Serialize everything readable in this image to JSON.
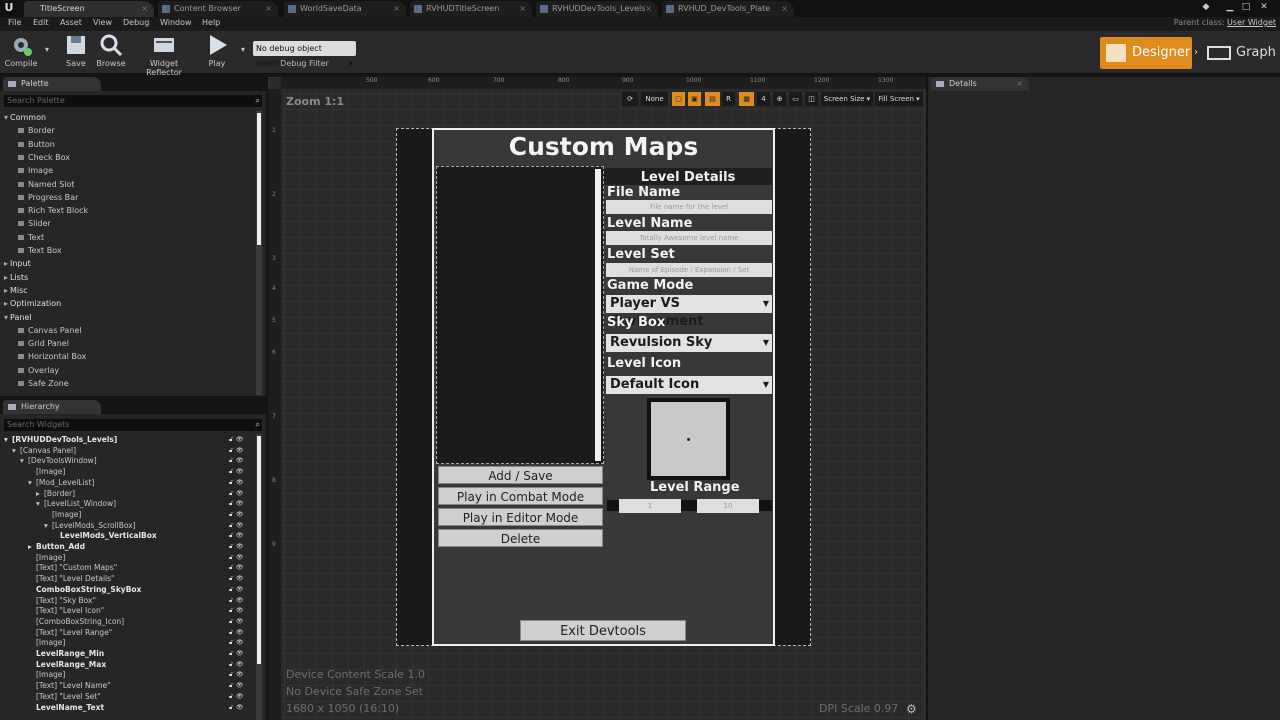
{
  "tabs": [
    {
      "label": "TitleScreen",
      "active": true
    },
    {
      "label": "Content Browser",
      "active": false
    },
    {
      "label": "WorldSaveData",
      "active": false
    },
    {
      "label": "RVHUDTitleScreen",
      "active": false
    },
    {
      "label": "RVHUDDevTools_Levels",
      "active": false
    },
    {
      "label": "RVHUD_DevTools_Plate",
      "active": false
    }
  ],
  "menu": [
    "File",
    "Edit",
    "Asset",
    "View",
    "Debug",
    "Window",
    "Help"
  ],
  "parent_class": {
    "prefix": "Parent class:",
    "value": "User Widget"
  },
  "toolbar": {
    "compile": "Compile",
    "save": "Save",
    "browse": "Browse",
    "widget_reflector": "Widget Reflector",
    "play": "Play",
    "debug_select": "No debug object selected",
    "debug_filter": "Debug Filter",
    "designer": "Designer",
    "graph": "Graph"
  },
  "palette": {
    "tab": "Palette",
    "search_placeholder": "Search Palette",
    "rows": [
      {
        "type": "cat",
        "label": "Common",
        "open": true
      },
      {
        "type": "item",
        "label": "Border"
      },
      {
        "type": "item",
        "label": "Button"
      },
      {
        "type": "item",
        "label": "Check Box"
      },
      {
        "type": "item",
        "label": "Image"
      },
      {
        "type": "item",
        "label": "Named Slot"
      },
      {
        "type": "item",
        "label": "Progress Bar"
      },
      {
        "type": "item",
        "label": "Rich Text Block"
      },
      {
        "type": "item",
        "label": "Slider"
      },
      {
        "type": "item",
        "label": "Text"
      },
      {
        "type": "item",
        "label": "Text Box"
      },
      {
        "type": "cat",
        "label": "Input",
        "open": false
      },
      {
        "type": "cat",
        "label": "Lists",
        "open": false
      },
      {
        "type": "cat",
        "label": "Misc",
        "open": false
      },
      {
        "type": "cat",
        "label": "Optimization",
        "open": false
      },
      {
        "type": "cat",
        "label": "Panel",
        "open": true
      },
      {
        "type": "item",
        "label": "Canvas Panel"
      },
      {
        "type": "item",
        "label": "Grid Panel"
      },
      {
        "type": "item",
        "label": "Horizontal Box"
      },
      {
        "type": "item",
        "label": "Overlay"
      },
      {
        "type": "item",
        "label": "Safe Zone"
      }
    ]
  },
  "hierarchy": {
    "tab": "Hierarchy",
    "search_placeholder": "Search Widgets",
    "rows": [
      {
        "label": "[RVHUDDevTools_Levels]",
        "indent": 0,
        "bold": true,
        "arrow": "▾"
      },
      {
        "label": "[Canvas Panel]",
        "indent": 1,
        "bold": false,
        "arrow": "▾"
      },
      {
        "label": "[DevToolsWindow]",
        "indent": 2,
        "bold": false,
        "arrow": "▾"
      },
      {
        "label": "[Image]",
        "indent": 3,
        "bold": false,
        "arrow": ""
      },
      {
        "label": "[Mod_LevelList]",
        "indent": 3,
        "bold": false,
        "arrow": "▾"
      },
      {
        "label": "[Border]",
        "indent": 4,
        "bold": false,
        "arrow": "▸"
      },
      {
        "label": "[LevelList_Window]",
        "indent": 4,
        "bold": false,
        "arrow": "▾"
      },
      {
        "label": "[Image]",
        "indent": 5,
        "bold": false,
        "arrow": ""
      },
      {
        "label": "[LevelMods_ScrollBox]",
        "indent": 5,
        "bold": false,
        "arrow": "▾"
      },
      {
        "label": "LevelMods_VerticalBox",
        "indent": 6,
        "bold": true,
        "arrow": ""
      },
      {
        "label": "Button_Add",
        "indent": 3,
        "bold": true,
        "arrow": "▸"
      },
      {
        "label": "[Image]",
        "indent": 3,
        "bold": false,
        "arrow": ""
      },
      {
        "label": "[Text] \"Custom Maps\"",
        "indent": 3,
        "bold": false,
        "arrow": ""
      },
      {
        "label": "[Text] \"Level Details\"",
        "indent": 3,
        "bold": false,
        "arrow": ""
      },
      {
        "label": "ComboBoxString_SkyBox",
        "indent": 3,
        "bold": true,
        "arrow": ""
      },
      {
        "label": "[Text] \"Sky Box\"",
        "indent": 3,
        "bold": false,
        "arrow": ""
      },
      {
        "label": "[Text] \"Level Icon\"",
        "indent": 3,
        "bold": false,
        "arrow": ""
      },
      {
        "label": "[ComboBoxString_Icon]",
        "indent": 3,
        "bold": false,
        "arrow": ""
      },
      {
        "label": "[Text] \"Level Range\"",
        "indent": 3,
        "bold": false,
        "arrow": ""
      },
      {
        "label": "[Image]",
        "indent": 3,
        "bold": false,
        "arrow": ""
      },
      {
        "label": "LevelRange_Min",
        "indent": 3,
        "bold": true,
        "arrow": ""
      },
      {
        "label": "LevelRange_Max",
        "indent": 3,
        "bold": true,
        "arrow": ""
      },
      {
        "label": "[Image]",
        "indent": 3,
        "bold": false,
        "arrow": ""
      },
      {
        "label": "[Text] \"Level Name\"",
        "indent": 3,
        "bold": false,
        "arrow": ""
      },
      {
        "label": "[Text] \"Level Set\"",
        "indent": 3,
        "bold": false,
        "arrow": ""
      },
      {
        "label": "LevelName_Text",
        "indent": 3,
        "bold": true,
        "arrow": ""
      }
    ]
  },
  "canvas": {
    "zoom": "Zoom 1:1",
    "ruler_h": [
      "500",
      "600",
      "700",
      "800",
      "900",
      "1000",
      "1100",
      "1200",
      "1300"
    ],
    "ruler_v": [
      "1",
      "2",
      "3",
      "4",
      "5",
      "6",
      "7",
      "8",
      "9"
    ],
    "tb_none": "None",
    "tb_r": "R",
    "tb_4": "4",
    "screen_size": "Screen Size",
    "fill_screen": "Fill Screen",
    "info_scale": "Device Content Scale 1.0",
    "info_safe": "No Device Safe Zone Set",
    "info_res": "1680 x 1050 (16:10)",
    "dpi": "DPI Scale 0.97"
  },
  "widget": {
    "title": "Custom Maps",
    "level_details": "Level Details",
    "file_name_label": "File Name",
    "file_name_placeholder": "File name for the level",
    "level_name_label": "Level Name",
    "level_name_placeholder": "Totally Awesome level name",
    "level_set_label": "Level Set",
    "level_set_placeholder": "Name of Episode / Expansion / Set",
    "game_mode_label": "Game Mode",
    "game_mode_value": "Player VS Environment",
    "sky_box_label": "Sky Box",
    "sky_box_value": "Revulsion Sky",
    "level_icon_label": "Level Icon",
    "level_icon_value": "Default Icon",
    "level_range_label": "Level Range",
    "range_min": "1",
    "range_max": "10",
    "btn_add": "Add / Save",
    "btn_combat": "Play in Combat Mode",
    "btn_editor": "Play in Editor Mode",
    "btn_delete": "Delete",
    "btn_exit": "Exit Devtools"
  },
  "details": {
    "tab": "Details"
  }
}
